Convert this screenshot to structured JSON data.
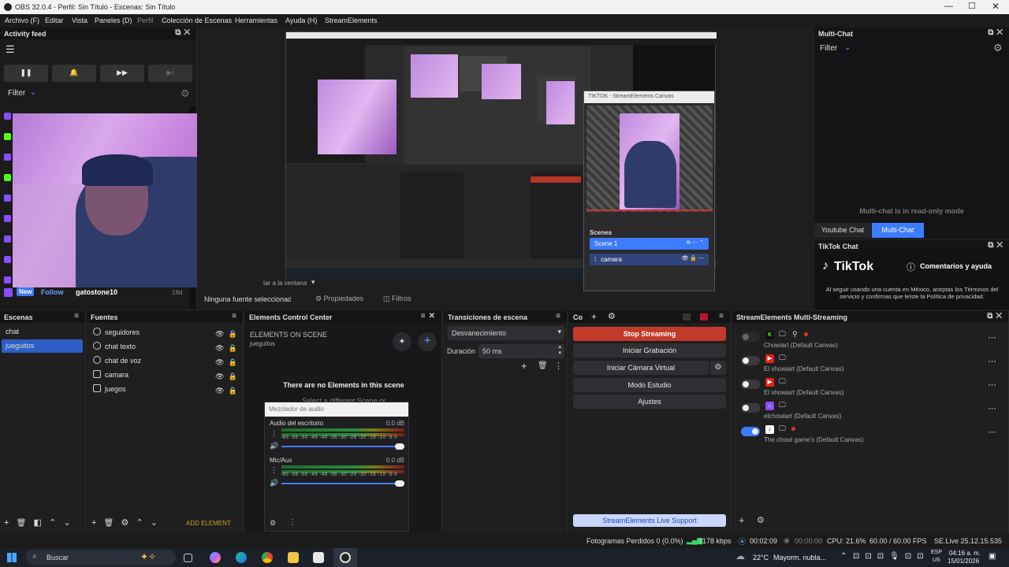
{
  "window": {
    "title": "OBS 32.0.4 - Perfil: Sin Título - Escenas: Sin Título"
  },
  "menu": [
    "Archivo (F)",
    "Editar",
    "Vista",
    "Paneles (D)",
    "Perfil",
    "Colección de Escenas",
    "Herramientas",
    "Ayuda (H)",
    "StreamElements"
  ],
  "activity_feed": {
    "title": "Activity feed",
    "filter_label": "Filter",
    "event": {
      "badge_new": "New",
      "badge_follow": "Follow",
      "user": "gatostone10",
      "age": "18d"
    }
  },
  "preview": {
    "no_source_label": "Ninguna fuente seleccionada",
    "properties_label": "Propiedades",
    "filters_label": "Filtros",
    "tiktok_canvas_title": "TIKTOK - StreamElements Canvas",
    "canvas_scenes_title": "Scenes",
    "canvas_scenes": [
      "Scene 1",
      "camara"
    ],
    "cropped_text": "tar a la ventana"
  },
  "multichat": {
    "title": "Multi-Chat",
    "filter_label": "Filter",
    "readonly_text": "Multi-chat is in read-only mode",
    "tabs": [
      "Youtube Chat",
      "Multi-Chat"
    ]
  },
  "tiktok_chat": {
    "title": "TikTok Chat",
    "logo_text": "TikTok",
    "help_text": "Comentarios y ayuda",
    "notice": "Al seguir usando una cuenta en México, aceptas los Términos del servicio y confirmas que leíste la Política de privacidad."
  },
  "scenes": {
    "title": "Escenas",
    "items": [
      "chat",
      "jueguitos"
    ],
    "selected": "jueguitos"
  },
  "sources": {
    "title": "Fuentes",
    "items": [
      "seguidores",
      "chat texto",
      "chat de voz",
      "camara",
      "juegos"
    ]
  },
  "ecc": {
    "title": "Elements Control Center",
    "header": "ELEMENTS ON SCENE",
    "scene": "jueguitos",
    "empty": "There are no Elements in this scene",
    "hint": "Select a different Scene or",
    "add_label": "ADD ELEMENT"
  },
  "mixer": {
    "title": "Mezclador de audio",
    "channels": [
      {
        "name": "Audio del escritorio",
        "db": "0.0 dB"
      },
      {
        "name": "Mic/Aux",
        "db": "0.0 dB"
      }
    ],
    "scale": "-60 -55 -50 -45 -40 -35 -30 -25 -20 -15 -10 -5 0"
  },
  "transitions": {
    "title": "Transiciones de escena",
    "selected": "Desvanecimiento",
    "duration_label": "Duración",
    "duration_value": "50 ms"
  },
  "controls": {
    "title": "Controles",
    "buttons": [
      "Stop Streaming",
      "Iniciar Grabación",
      "Iniciar Cámara Virtual",
      "Modo Estudio",
      "Ajustes"
    ],
    "support": "StreamElements Live Support"
  },
  "multistream": {
    "title": "StreamElements Multi-Streaming",
    "rows": [
      {
        "name": "Chowiart (Default Canvas)",
        "platform": "kick",
        "on": false
      },
      {
        "name": "El showiart (Default Canvas)",
        "platform": "youtube",
        "on": false
      },
      {
        "name": "El showiart (Default Canvas)",
        "platform": "youtube",
        "on": false
      },
      {
        "name": "elchowiart (Default Canvas)",
        "platform": "twitch",
        "on": false
      },
      {
        "name": "The chowi game's (Default Canvas)",
        "platform": "tiktok",
        "on": true
      }
    ]
  },
  "statusbar": {
    "dropped": "Fotogramas Perdidos 0 (0.0%)",
    "bitrate": "7178 kbps",
    "stream_time": "00:02:09",
    "rec_time": "00:00:00",
    "cpu": "CPU: 21.6%",
    "fps": "60.00 / 60.00 FPS",
    "version": "SE.Live 25.12.15.535"
  },
  "taskbar": {
    "search": "Buscar",
    "weather": "22°C",
    "weather_desc": "Mayorm. nubla...",
    "lang": "ESP",
    "region": "US",
    "time": "04:16 a. m.",
    "date": "15/01/2026"
  },
  "colors": {
    "accent": "#3d7bff",
    "stop": "#c23a2a",
    "panel": "#1f1f20",
    "header": "#141414"
  }
}
